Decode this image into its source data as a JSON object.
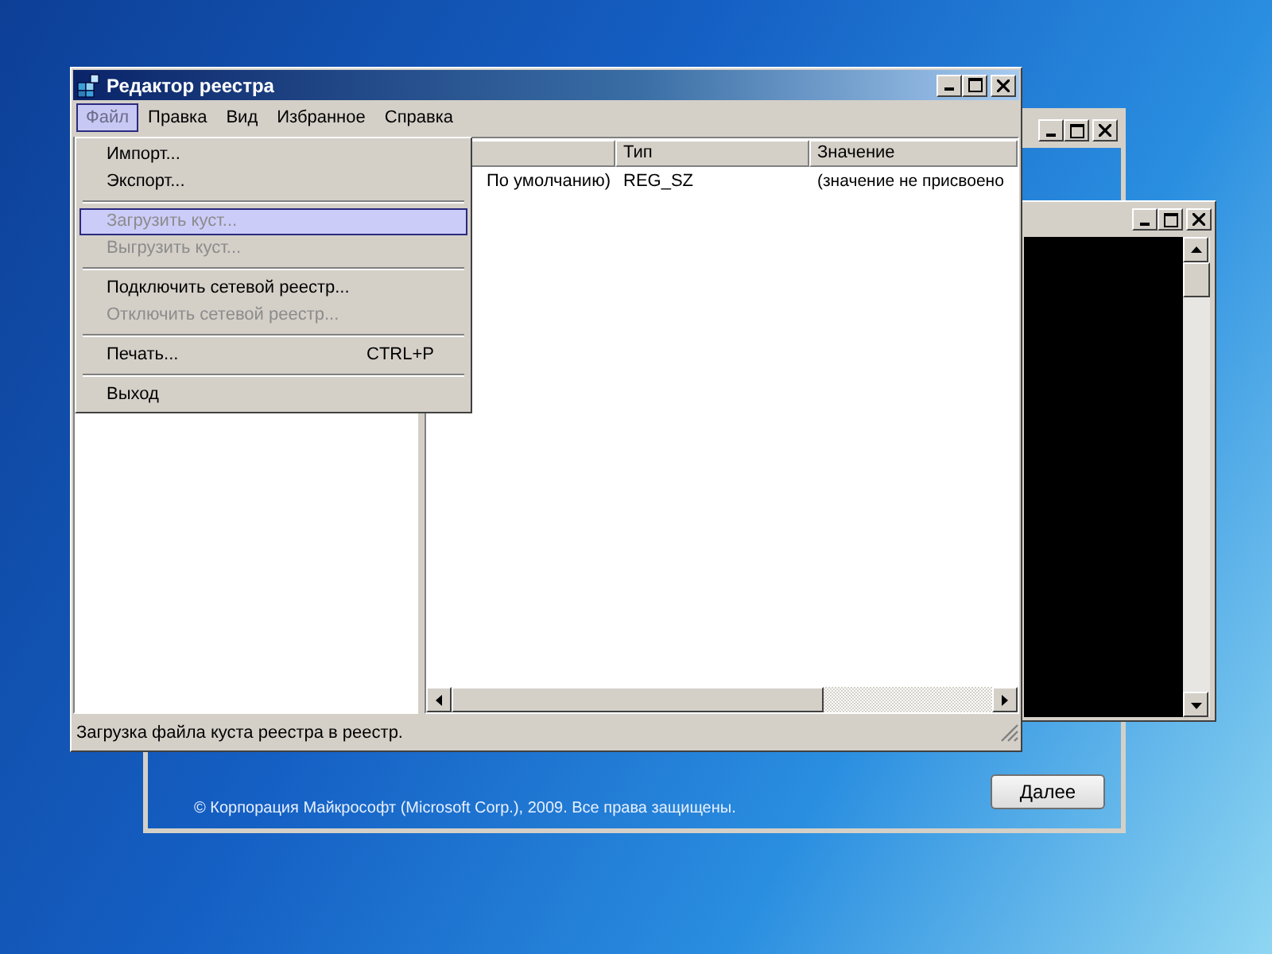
{
  "setup_window": {
    "copyright": "© Корпорация Майкрософт (Microsoft Corp.), 2009. Все права защищены.",
    "next_button": "Далее"
  },
  "regedit": {
    "title": "Редактор реестра",
    "menu": [
      {
        "label": "Файл",
        "selected": true
      },
      {
        "label": "Правка",
        "selected": false
      },
      {
        "label": "Вид",
        "selected": false
      },
      {
        "label": "Избранное",
        "selected": false
      },
      {
        "label": "Справка",
        "selected": false
      }
    ],
    "columns": [
      "Тип",
      "Значение"
    ],
    "rows": [
      {
        "column_1": "По умолчанию)",
        "type": "REG_SZ",
        "value": "(значение не присвоено"
      }
    ],
    "status_bar": "Загрузка файла куста реестра в реестр."
  },
  "file_menu": [
    {
      "kind": "item",
      "label": "Импорт...",
      "disabled": false,
      "selected": false
    },
    {
      "kind": "item",
      "label": "Экспорт...",
      "disabled": false,
      "selected": false
    },
    {
      "kind": "separator"
    },
    {
      "kind": "item",
      "label": "Загрузить куст...",
      "disabled": true,
      "selected": true
    },
    {
      "kind": "item",
      "label": "Выгрузить куст...",
      "disabled": true,
      "selected": false
    },
    {
      "kind": "separator"
    },
    {
      "kind": "item",
      "label": "Подключить сетевой реестр...",
      "disabled": false,
      "selected": false
    },
    {
      "kind": "item",
      "label": "Отключить сетевой реестр...",
      "disabled": true,
      "selected": false
    },
    {
      "kind": "separator"
    },
    {
      "kind": "item",
      "label": "Печать...",
      "shortcut": "CTRL+P",
      "disabled": false,
      "selected": false
    },
    {
      "kind": "separator"
    },
    {
      "kind": "item",
      "label": "Выход",
      "disabled": false,
      "selected": false
    }
  ]
}
